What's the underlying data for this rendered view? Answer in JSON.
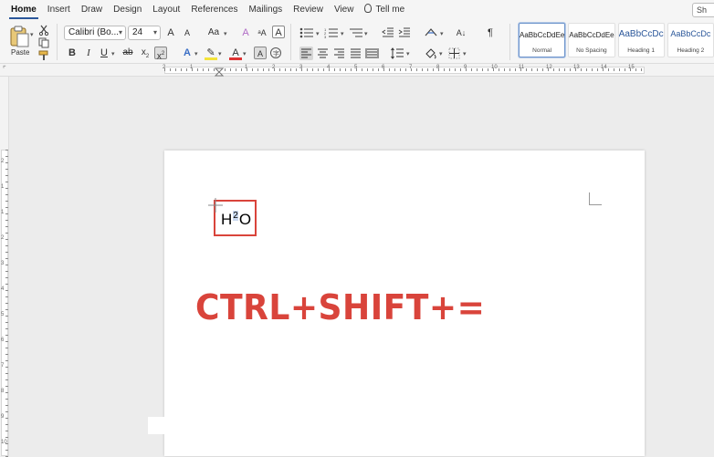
{
  "tabs": [
    {
      "label": "Home",
      "active": true
    },
    {
      "label": "Insert"
    },
    {
      "label": "Draw"
    },
    {
      "label": "Design"
    },
    {
      "label": "Layout"
    },
    {
      "label": "References"
    },
    {
      "label": "Mailings"
    },
    {
      "label": "Review"
    },
    {
      "label": "View"
    }
  ],
  "tellme": "Tell me",
  "share_label": "Sh",
  "clipboard": {
    "paste_label": "Paste"
  },
  "font": {
    "family": "Calibri (Bo...",
    "size": "24"
  },
  "glyphs": {
    "grow": "A",
    "shrink": "A",
    "change_case": "Aa",
    "bold": "B",
    "italic": "I",
    "underline": "U",
    "strike": "ab",
    "subscript": "x",
    "superscript": "x",
    "text_effects": "A",
    "highlight": "✎",
    "font_color": "A",
    "char_shading": "A",
    "pilcrow": "¶",
    "sort": "A↓"
  },
  "styles": [
    {
      "sample": "AaBbCcDdEe",
      "name": "Normal",
      "selected": true
    },
    {
      "sample": "AaBbCcDdEe",
      "name": "No Spacing"
    },
    {
      "sample": "AaBbCcDc",
      "name": "Heading 1"
    },
    {
      "sample": "AaBbCcDc",
      "name": "Heading 2"
    }
  ],
  "ruler_numbers": [
    "2",
    "1",
    "1",
    "2",
    "3",
    "4",
    "5",
    "6",
    "7",
    "8",
    "9",
    "10",
    "11",
    "12",
    "13",
    "14",
    "15"
  ],
  "vruler_numbers": [
    "2",
    "1",
    "1",
    "2",
    "3",
    "4",
    "5",
    "6",
    "7",
    "8",
    "9",
    "10"
  ],
  "document": {
    "h2o_base": "H",
    "h2o_sup": "2",
    "h2o_tail": "O",
    "shortcut_text": "CTRL+SHIFT+="
  },
  "colors": {
    "accent": "#2b579a",
    "highlight_red": "#d9443b"
  }
}
